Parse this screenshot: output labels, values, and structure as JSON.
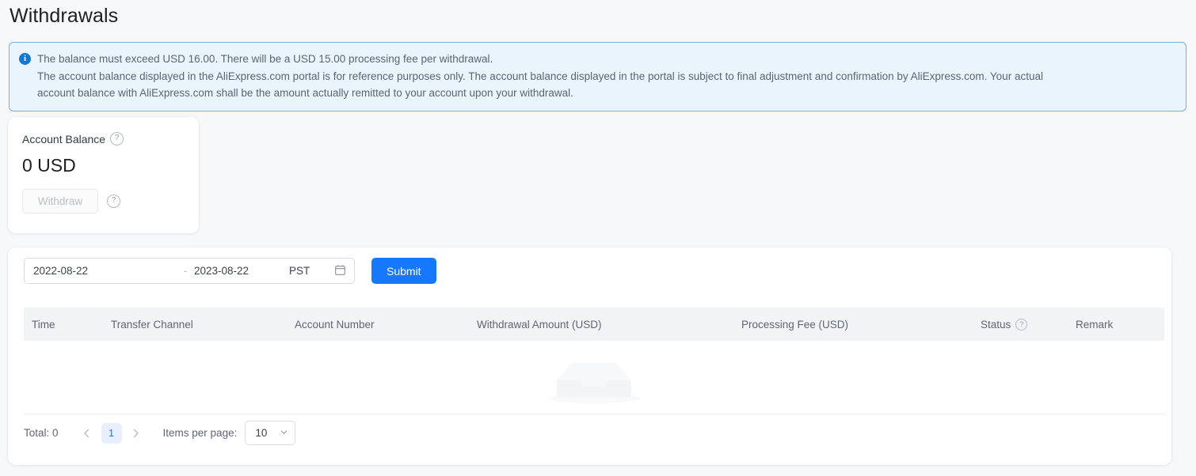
{
  "page": {
    "title": "Withdrawals"
  },
  "banner": {
    "icon": "info-icon",
    "line1": "The balance must exceed USD 16.00. There will be a USD 15.00 processing fee per withdrawal.",
    "line2": "The account balance displayed in the AliExpress.com portal is for reference purposes only. The account balance displayed in the portal is subject to final adjustment and confirmation by AliExpress.com. Your actual",
    "line3": "account balance with AliExpress.com shall be the amount actually remitted to your account upon your withdrawal.",
    "bg_color": "#eaf4fd",
    "border_color": "#7eaed0",
    "icon_color": "#1677d2"
  },
  "balance_card": {
    "label": "Account Balance",
    "help_icon": "question-mark-icon",
    "amount": "0 USD",
    "withdraw_label": "Withdraw",
    "withdraw_help_icon": "question-mark-icon",
    "withdraw_disabled": true
  },
  "filters": {
    "start_date": "2022-08-22",
    "separator": "-",
    "end_date": "2023-08-22",
    "timezone": "PST",
    "calendar_icon": "calendar-icon",
    "submit_label": "Submit",
    "submit_color": "#1677ff"
  },
  "table": {
    "columns": [
      {
        "label": "Time",
        "help": false
      },
      {
        "label": "Transfer Channel",
        "help": false
      },
      {
        "label": "Account Number",
        "help": false
      },
      {
        "label": "Withdrawal Amount (USD)",
        "help": false
      },
      {
        "label": "Processing Fee (USD)",
        "help": false
      },
      {
        "label": "Status",
        "help": true
      },
      {
        "label": "Remark",
        "help": false
      }
    ],
    "rows": [],
    "header_bg": "#f2f3f5"
  },
  "pagination": {
    "total_label": "Total: 0",
    "prev_icon": "chevron-left-icon",
    "current_page": "1",
    "next_icon": "chevron-right-icon",
    "items_per_page_label": "Items per page:",
    "items_per_page_value": "10",
    "chevron_icon": "chevron-down-icon",
    "active_bg": "#e8effb",
    "active_color": "#2b7ae3"
  }
}
